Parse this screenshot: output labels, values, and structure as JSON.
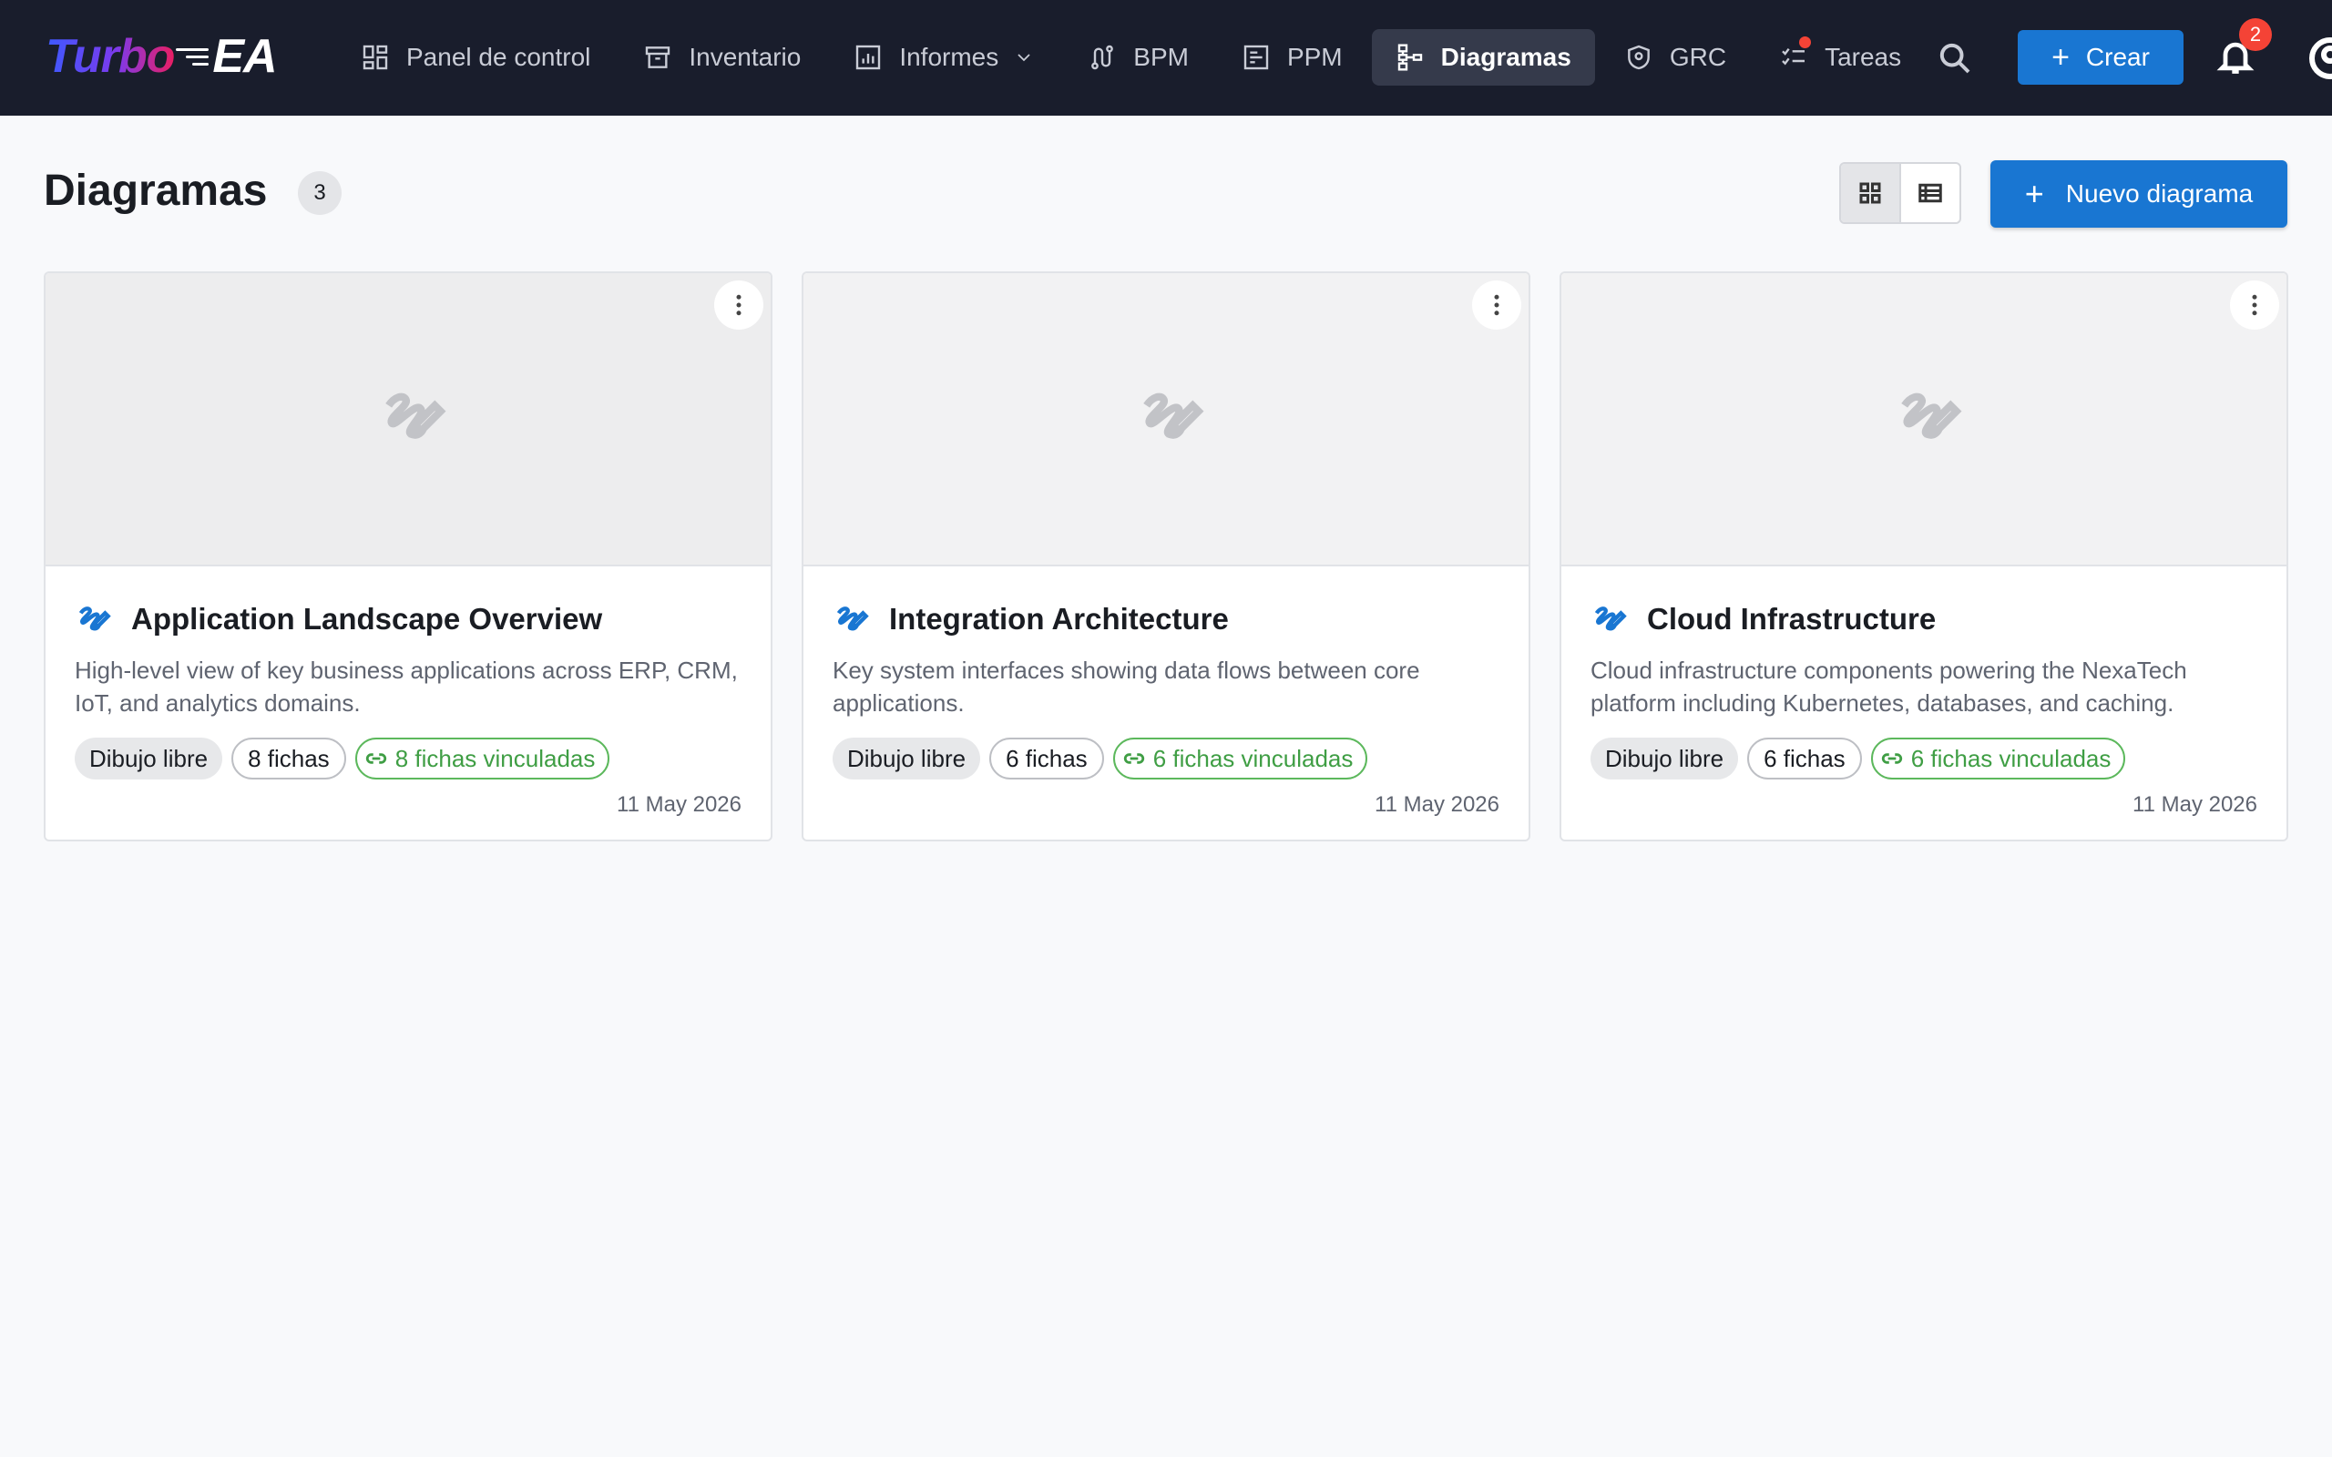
{
  "app": {
    "logo_turbo": "Turbo",
    "logo_ea": "EA"
  },
  "nav": {
    "items": [
      {
        "label": "Panel de control",
        "icon": "dashboard-icon"
      },
      {
        "label": "Inventario",
        "icon": "archive-icon"
      },
      {
        "label": "Informes",
        "icon": "report-icon"
      },
      {
        "label": "BPM",
        "icon": "route-icon"
      },
      {
        "label": "PPM",
        "icon": "project-icon"
      },
      {
        "label": "Diagramas",
        "icon": "schema-icon"
      },
      {
        "label": "GRC",
        "icon": "shield-icon"
      },
      {
        "label": "Tareas",
        "icon": "checklist-icon"
      }
    ],
    "active": "Diagramas",
    "crear_label": "Crear",
    "notification_count": "2"
  },
  "page": {
    "title": "Diagramas",
    "count": "3",
    "view_mode": "grid",
    "new_button_label": "Nuevo diagrama"
  },
  "cards": [
    {
      "title": "Application Landscape Overview",
      "description": "High-level view of key business applications across ERP, CRM, IoT, and analytics domains.",
      "type_label": "Dibujo libre",
      "cards_label": "8 fichas",
      "linked_label": "8 fichas vinculadas",
      "date": "11 May 2026"
    },
    {
      "title": "Integration Architecture",
      "description": "Key system interfaces showing data flows between core applications.",
      "type_label": "Dibujo libre",
      "cards_label": "6 fichas",
      "linked_label": "6 fichas vinculadas",
      "date": "11 May 2026"
    },
    {
      "title": "Cloud Infrastructure",
      "description": "Cloud infrastructure components powering the NexaTech platform including Kubernetes, databases, and caching.",
      "type_label": "Dibujo libre",
      "cards_label": "6 fichas",
      "linked_label": "6 fichas vinculadas",
      "date": "11 May 2026"
    }
  ],
  "colors": {
    "topbar": "#191d2c",
    "primary": "#1976d2",
    "linked_green": "#3f9e44",
    "badge_red": "#f44336"
  }
}
